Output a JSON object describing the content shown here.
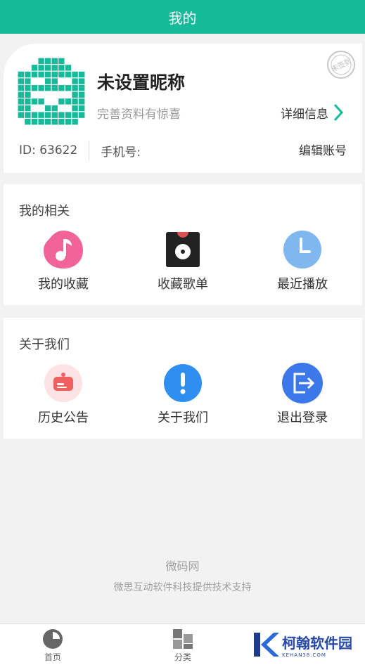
{
  "header": {
    "title": "我的"
  },
  "profile": {
    "nickname": "未设置昵称",
    "subtitle": "完善资料有惊喜",
    "detail_label": "详细信息",
    "stamp_text": "未签到",
    "id_text": "ID: 63622",
    "phone_label": "手机号:",
    "edit_label": "编辑账号"
  },
  "my_related": {
    "title": "我的相关",
    "items": [
      {
        "label": "我的收藏",
        "icon": "music-note-icon",
        "color": "#f0649a"
      },
      {
        "label": "收藏歌单",
        "icon": "vinyl-record-icon",
        "color": "#222222"
      },
      {
        "label": "最近播放",
        "icon": "clock-icon",
        "color": "#6aaaf0"
      }
    ]
  },
  "about": {
    "title": "关于我们",
    "items": [
      {
        "label": "历史公告",
        "icon": "announcement-icon",
        "color": "#f06060"
      },
      {
        "label": "关于我们",
        "icon": "info-exclamation-icon",
        "color": "#2f8ff0"
      },
      {
        "label": "退出登录",
        "icon": "logout-icon",
        "color": "#3c78e8"
      }
    ]
  },
  "footer": {
    "brand": "微码网",
    "support": "微思互动软件科技提供技术支持"
  },
  "tabbar": {
    "items": [
      {
        "label": "首页",
        "icon": "home-pie-icon"
      },
      {
        "label": "分类",
        "icon": "category-grid-icon"
      }
    ]
  },
  "watermark": {
    "text": "柯翰软件园",
    "sub": "KEHAN38.COM"
  },
  "colors": {
    "accent": "#16b99a",
    "page_bg": "#f2f2f2"
  }
}
